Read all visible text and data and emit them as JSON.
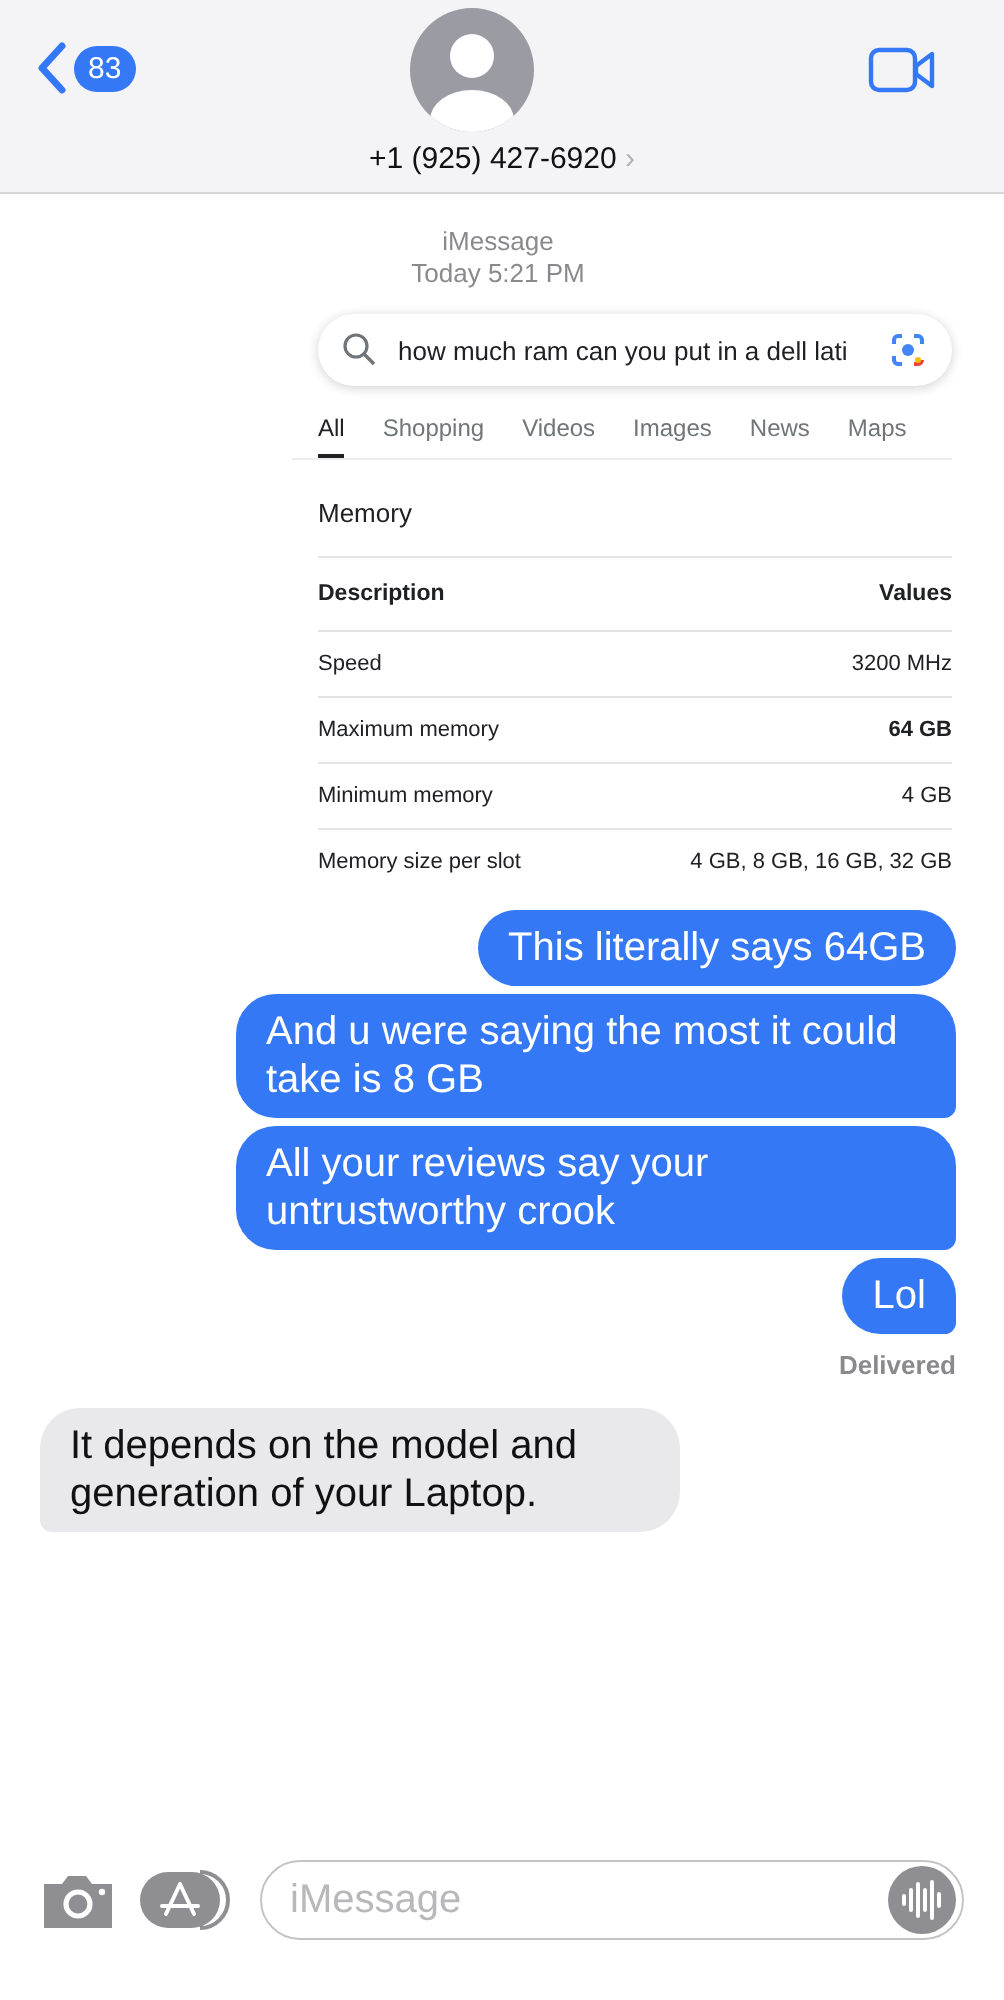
{
  "header": {
    "back_count": "83",
    "contact": "+1 (925) 427-6920",
    "chevron": "›"
  },
  "thread": {
    "service": "iMessage",
    "timestamp": "Today 5:21 PM"
  },
  "messages": [
    {
      "kind": "screenshot",
      "search": {
        "query": "how much ram can you put in a dell lati"
      },
      "tabs": [
        {
          "label": "All",
          "selected": true
        },
        {
          "label": "Shopping",
          "selected": false
        },
        {
          "label": "Videos",
          "selected": false
        },
        {
          "label": "Images",
          "selected": false
        },
        {
          "label": "News",
          "selected": false
        },
        {
          "label": "Maps",
          "selected": false
        }
      ],
      "section": "Memory",
      "table": {
        "columns": [
          "Description",
          "Values"
        ],
        "rows": [
          {
            "label": "Speed",
            "value": "3200 MHz",
            "bold": false
          },
          {
            "label": "Maximum memory",
            "value": "64 GB",
            "bold": true
          },
          {
            "label": "Minimum memory",
            "value": "4 GB",
            "bold": false
          },
          {
            "label": "Memory size per slot",
            "value": "4 GB, 8 GB, 16 GB, 32 GB",
            "bold": false
          }
        ]
      }
    },
    {
      "kind": "sent",
      "text": "This literally says 64GB",
      "tail": false
    },
    {
      "kind": "sent",
      "text": "And u were saying the most it could take is 8 GB",
      "tail": true
    },
    {
      "kind": "sent",
      "text": "All your reviews say your untrustworthy crook",
      "tail": true
    },
    {
      "kind": "sent",
      "text": "Lol",
      "tail": true
    },
    {
      "kind": "status",
      "text": "Delivered"
    },
    {
      "kind": "received",
      "text": "It depends on the model and generation of your Laptop.",
      "tail": true
    }
  ],
  "composer": {
    "placeholder": "iMessage"
  }
}
